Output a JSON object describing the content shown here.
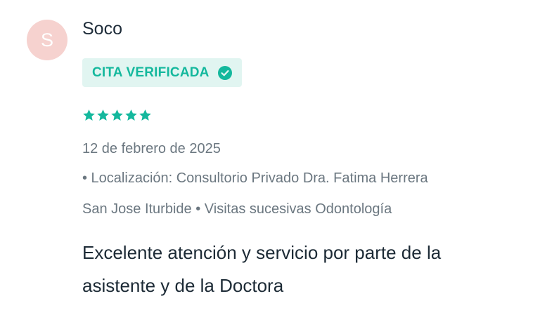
{
  "review": {
    "avatar_initial": "S",
    "author": "Soco",
    "badge_label": "CITA VERIFICADA",
    "rating_stars": 5,
    "date": "12 de febrero de 2025",
    "meta_line_1": "• Localización: Consultorio Privado Dra. Fatima Herrera",
    "meta_line_2": "San Jose Iturbide • Visitas sucesivas Odontología",
    "comment": "Excelente atención y servicio por parte de la asistente y de la Doctora"
  },
  "colors": {
    "accent": "#14b89d",
    "badge_bg": "#e1f5f1",
    "avatar_bg": "#f6d2cf",
    "muted_text": "#6b7780"
  },
  "icons": [
    "check-circle-icon",
    "star-icon"
  ]
}
